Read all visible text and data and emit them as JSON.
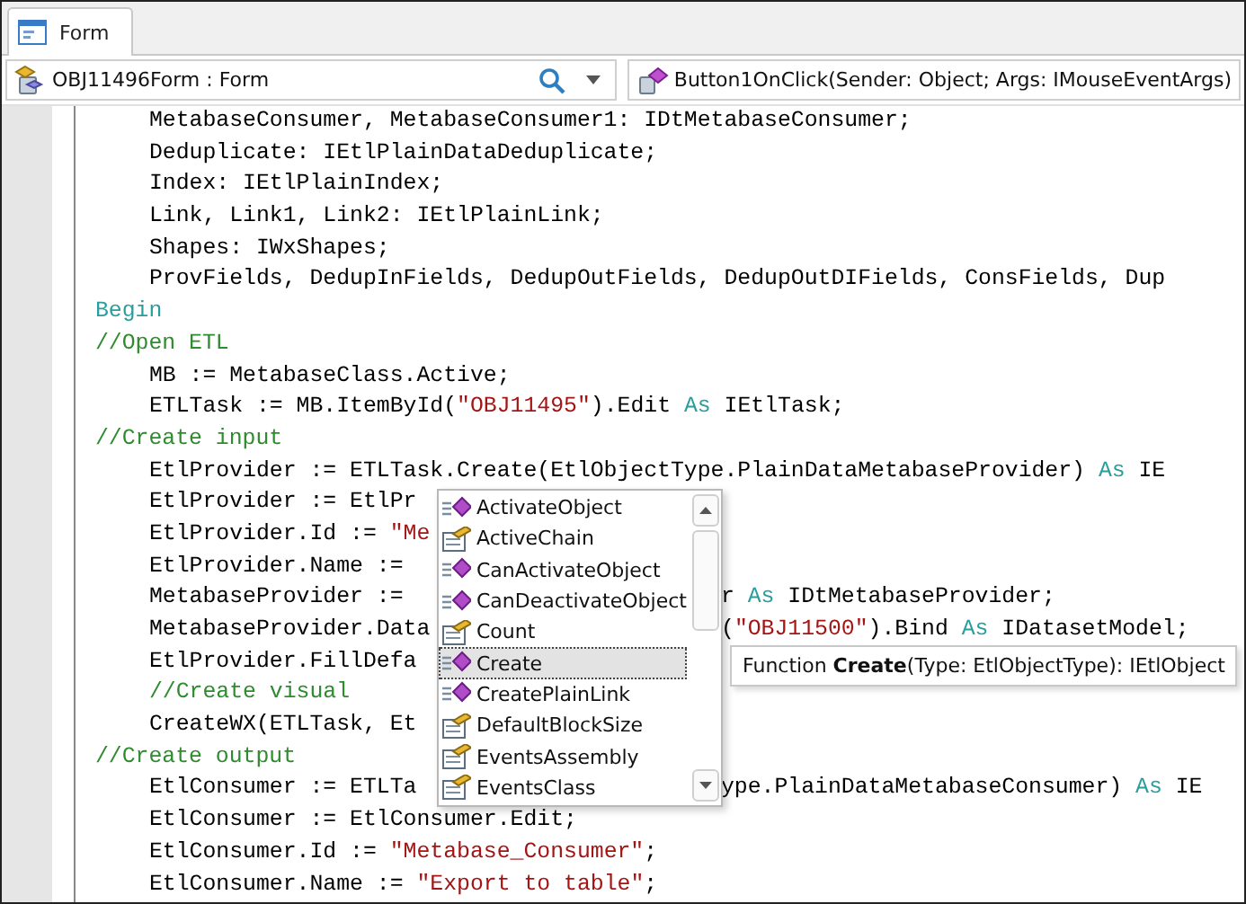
{
  "tabs": [
    {
      "label": "Form",
      "selected": true
    }
  ],
  "object_selector": {
    "value": "OBJ11496Form : Form"
  },
  "method_selector": {
    "value": "Button1OnClick(Sender: Object; Args: IMouseEventArgs)"
  },
  "code_lines": [
    {
      "indented": true,
      "left": [
        {
          "t": "MetabaseConsumer, MetabaseConsumer1: IDtMetabaseConsumer;",
          "kind": "plain"
        }
      ]
    },
    {
      "indented": true,
      "left": [
        {
          "t": "Deduplicate: IEtlPlainDataDeduplicate;",
          "kind": "plain"
        }
      ]
    },
    {
      "indented": true,
      "left": [
        {
          "t": "Index: IEtlPlainIndex;",
          "kind": "plain"
        }
      ]
    },
    {
      "indented": true,
      "left": [
        {
          "t": "Link, Link1, Link2: IEtlPlainLink;",
          "kind": "plain"
        }
      ]
    },
    {
      "indented": true,
      "left": [
        {
          "t": "Shapes: IWxShapes;",
          "kind": "plain"
        }
      ]
    },
    {
      "indented": true,
      "left": [
        {
          "t": "ProvFields, DedupInFields, DedupOutFields, DedupOutDIFields, ConsFields, Dup",
          "kind": "plain"
        }
      ]
    },
    {
      "indented": false,
      "left": [
        {
          "t": "Begin",
          "kind": "keyword"
        }
      ]
    },
    {
      "indented": false,
      "left": [
        {
          "t": "//Open ETL",
          "kind": "comment"
        }
      ]
    },
    {
      "indented": true,
      "left": [
        {
          "t": "MB := MetabaseClass.Active;",
          "kind": "plain"
        }
      ]
    },
    {
      "indented": true,
      "left": [
        {
          "t": "ETLTask := MB.ItemById(",
          "kind": "plain"
        },
        {
          "t": "\"OBJ11495\"",
          "kind": "string"
        },
        {
          "t": ").Edit ",
          "kind": "plain"
        },
        {
          "t": "As",
          "kind": "keyword"
        },
        {
          "t": " IEtlTask;",
          "kind": "plain"
        }
      ]
    },
    {
      "indented": false,
      "left": [
        {
          "t": "//Create input",
          "kind": "comment"
        }
      ]
    },
    {
      "indented": true,
      "left": [
        {
          "t": "EtlProvider := ETLTask.Create(EtlObjectType.PlainDataMetabaseProvider) ",
          "kind": "plain"
        },
        {
          "t": "As",
          "kind": "keyword"
        },
        {
          "t": " IE",
          "kind": "plain"
        }
      ]
    },
    {
      "indented": true,
      "covered": true,
      "left": [
        {
          "t": "EtlProvider := EtlPr",
          "kind": "plain"
        }
      ]
    },
    {
      "indented": true,
      "covered": true,
      "left": [
        {
          "t": "EtlProvider.Id := ",
          "kind": "plain"
        },
        {
          "t": "\"Me",
          "kind": "string"
        }
      ]
    },
    {
      "indented": true,
      "covered": true,
      "left": [
        {
          "t": "EtlProvider.Name := ",
          "kind": "plain"
        }
      ]
    },
    {
      "indented": true,
      "covered": true,
      "left": [
        {
          "t": "MetabaseProvider := ",
          "kind": "plain"
        }
      ],
      "right": [
        {
          "t": "r ",
          "kind": "plain"
        },
        {
          "t": "As",
          "kind": "keyword"
        },
        {
          "t": " IDtMetabaseProvider;",
          "kind": "plain"
        }
      ]
    },
    {
      "indented": true,
      "covered": true,
      "left": [
        {
          "t": "MetabaseProvider.Data",
          "kind": "plain"
        }
      ],
      "right": [
        {
          "t": "(",
          "kind": "plain"
        },
        {
          "t": "\"OBJ11500\"",
          "kind": "string"
        },
        {
          "t": ").Bind ",
          "kind": "plain"
        },
        {
          "t": "As",
          "kind": "keyword"
        },
        {
          "t": " IDatasetModel;",
          "kind": "plain"
        }
      ]
    },
    {
      "indented": true,
      "covered": true,
      "left": [
        {
          "t": "EtlProvider.FillDefa",
          "kind": "plain"
        }
      ]
    },
    {
      "indented": true,
      "covered": true,
      "left": [
        {
          "t": "//Create visual",
          "kind": "comment"
        }
      ]
    },
    {
      "indented": true,
      "covered": true,
      "left": [
        {
          "t": "CreateWX(ETLTask, Et",
          "kind": "plain"
        }
      ]
    },
    {
      "indented": false,
      "covered": true,
      "left": [
        {
          "t": "//Create output",
          "kind": "comment"
        }
      ]
    },
    {
      "indented": true,
      "covered": true,
      "left": [
        {
          "t": "EtlConsumer := ETLTa",
          "kind": "plain"
        }
      ],
      "right": [
        {
          "t": "ype.PlainDataMetabaseConsumer) ",
          "kind": "plain"
        },
        {
          "t": "As",
          "kind": "keyword"
        },
        {
          "t": " IE",
          "kind": "plain"
        }
      ]
    },
    {
      "indented": true,
      "left": [
        {
          "t": "EtlConsumer := EtlConsumer.Edit;",
          "kind": "plain"
        }
      ]
    },
    {
      "indented": true,
      "left": [
        {
          "t": "EtlConsumer.Id := ",
          "kind": "plain"
        },
        {
          "t": "\"Metabase_Consumer\"",
          "kind": "string"
        },
        {
          "t": ";",
          "kind": "plain"
        }
      ]
    },
    {
      "indented": true,
      "left": [
        {
          "t": "EtlConsumer.Name := ",
          "kind": "plain"
        },
        {
          "t": "\"Export to table\"",
          "kind": "string"
        },
        {
          "t": ";",
          "kind": "plain"
        }
      ]
    }
  ],
  "completion_list": [
    {
      "label": "ActivateObject",
      "kind": "method",
      "selected": false
    },
    {
      "label": "ActiveChain",
      "kind": "property",
      "selected": false
    },
    {
      "label": "CanActivateObject",
      "kind": "method",
      "selected": false
    },
    {
      "label": "CanDeactivateObject",
      "kind": "method",
      "selected": false
    },
    {
      "label": "Count",
      "kind": "property",
      "selected": false
    },
    {
      "label": "Create",
      "kind": "method",
      "selected": true
    },
    {
      "label": "CreatePlainLink",
      "kind": "method",
      "selected": false
    },
    {
      "label": "DefaultBlockSize",
      "kind": "property",
      "selected": false
    },
    {
      "label": "EventsAssembly",
      "kind": "property",
      "selected": false
    },
    {
      "label": "EventsClass",
      "kind": "property",
      "selected": false
    }
  ],
  "tooltip": "Function **Create**(Type: EtlObjectType): IEtlObject"
}
